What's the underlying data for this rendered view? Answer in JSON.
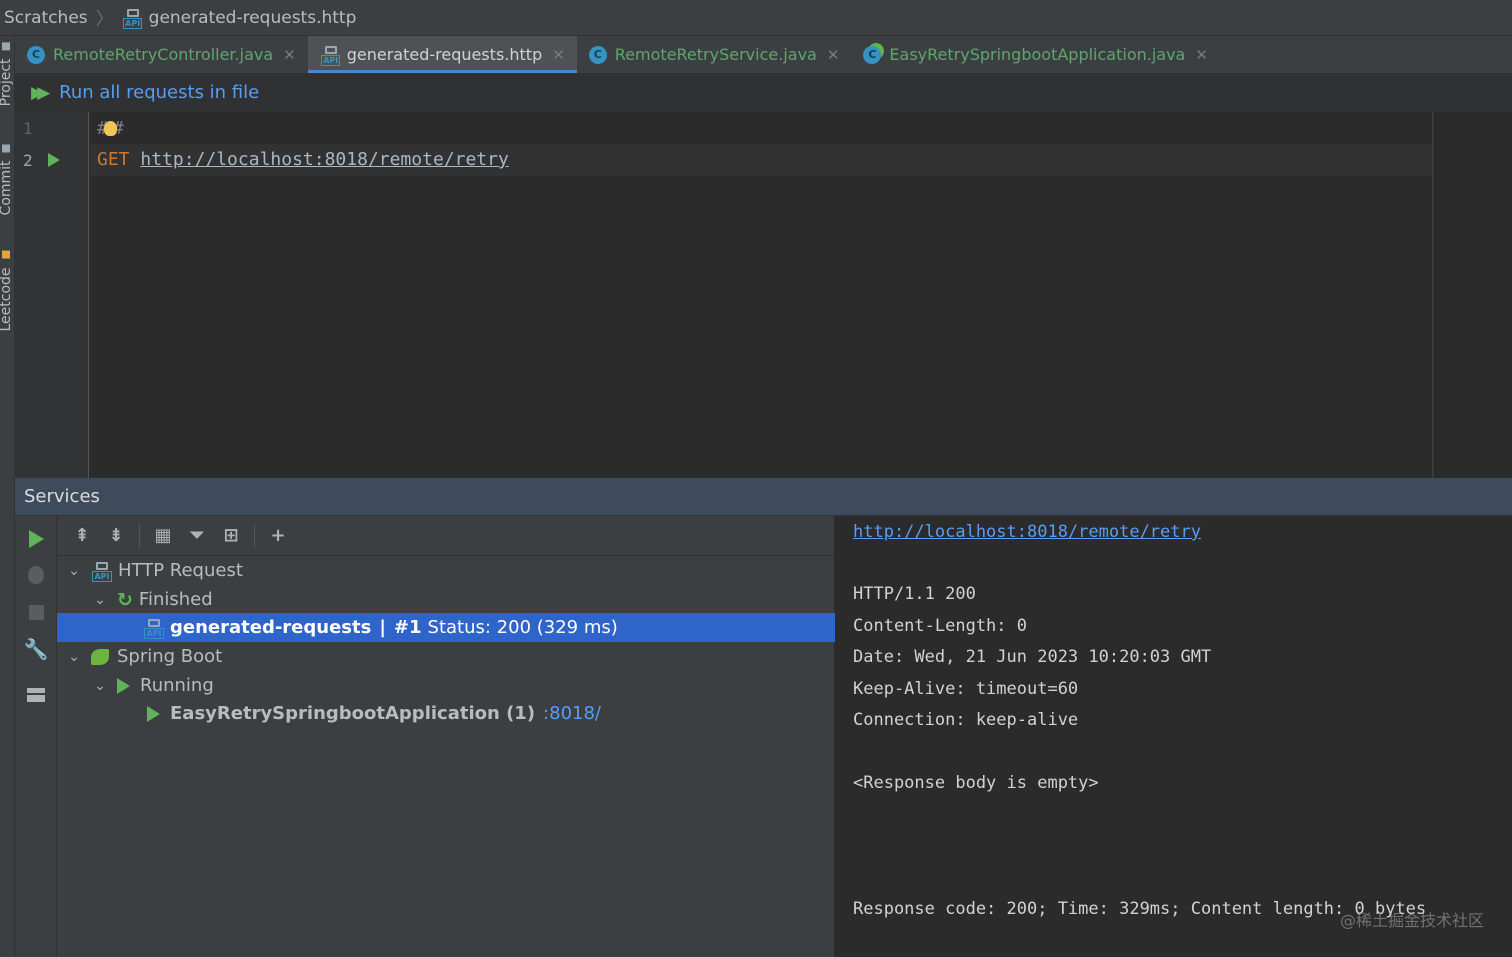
{
  "breadcrumb": {
    "root": "Scratches",
    "file": "generated-requests.http"
  },
  "side_tabs": {
    "project": "Project",
    "commit": "Commit",
    "leetcode": "Leetcode"
  },
  "tabs": [
    {
      "label": "RemoteRetryController.java",
      "icon": "class-icon",
      "active": false
    },
    {
      "label": "generated-requests.http",
      "icon": "api-icon",
      "active": true
    },
    {
      "label": "RemoteRetryService.java",
      "icon": "class-icon",
      "active": false
    },
    {
      "label": "EasyRetrySpringbootApplication.java",
      "icon": "spring-class-icon",
      "active": false
    }
  ],
  "run_bar": {
    "label": "Run all requests in file"
  },
  "editor": {
    "lines": [
      {
        "number": "1",
        "hash_a": "#",
        "hash_b": "#"
      },
      {
        "number": "2",
        "method": "GET",
        "url": "http://localhost:8018/remote/retry"
      }
    ]
  },
  "services": {
    "title": "Services",
    "tree": {
      "http_request": "HTTP Request",
      "finished": "Finished",
      "request_name": "generated-requests",
      "request_sep": "|",
      "request_num": "#1",
      "request_status": "Status: 200 (329 ms)",
      "spring_boot": "Spring Boot",
      "running": "Running",
      "app_name": "EasyRetrySpringbootApplication (1)",
      "app_port": ":8018/"
    },
    "response": {
      "url": "http://localhost:8018/remote/retry",
      "status_line": "HTTP/1.1 200",
      "headers": [
        "Content-Length: 0",
        "Date: Wed, 21 Jun 2023 10:20:03 GMT",
        "Keep-Alive: timeout=60",
        "Connection: keep-alive"
      ],
      "body": "<Response body is empty>",
      "summary": "Response code: 200; Time: 329ms; Content length: 0 bytes"
    }
  },
  "watermark": "@稀土掘金技术社区",
  "colors": {
    "accent": "#589df6",
    "run_green": "#5fb358",
    "selection": "#2f65ca",
    "keyword": "#cc7832"
  }
}
